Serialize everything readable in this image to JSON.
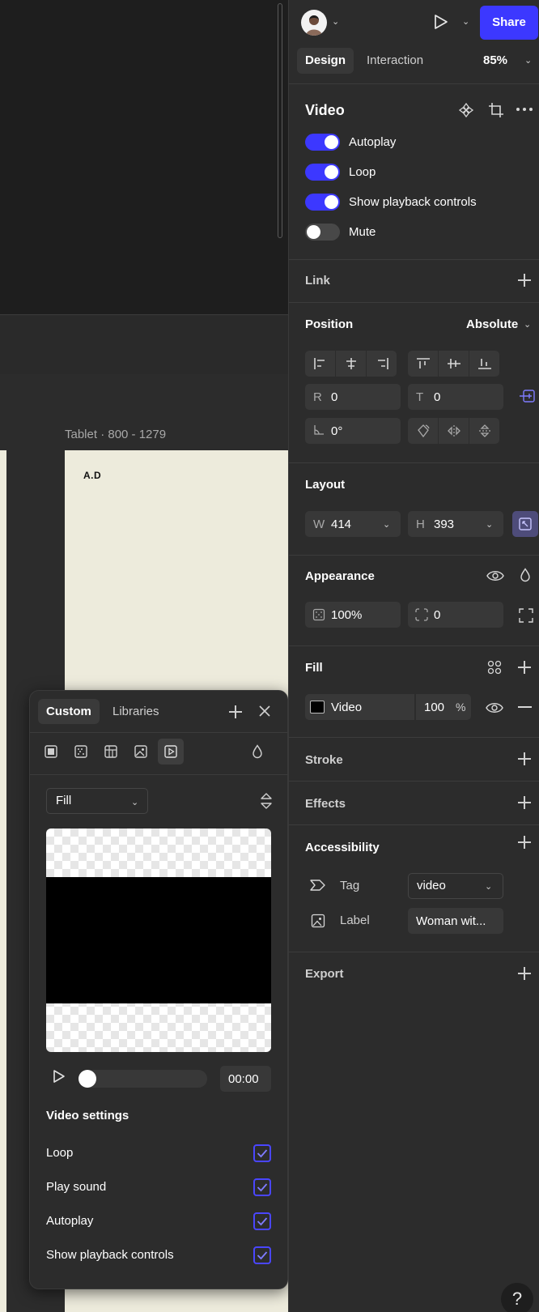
{
  "header": {
    "share_label": "Share",
    "tabs": [
      {
        "label": "Design",
        "active": true
      },
      {
        "label": "Interaction",
        "active": false
      }
    ],
    "zoom": "85%"
  },
  "canvas": {
    "frame_label": "Tablet · 800 - 1279",
    "frame_text": "A.D"
  },
  "video": {
    "title": "Video",
    "toggles": [
      {
        "label": "Autoplay",
        "on": true
      },
      {
        "label": "Loop",
        "on": true
      },
      {
        "label": "Show playback controls",
        "on": true
      },
      {
        "label": "Mute",
        "on": false
      }
    ]
  },
  "link": {
    "title": "Link"
  },
  "position": {
    "title": "Position",
    "mode": "Absolute",
    "r_label": "R",
    "r_value": "0",
    "t_label": "T",
    "t_value": "0",
    "rotation": "0°"
  },
  "layout": {
    "title": "Layout",
    "w_label": "W",
    "w_value": "414",
    "h_label": "H",
    "h_value": "393"
  },
  "appearance": {
    "title": "Appearance",
    "opacity": "100%",
    "radius": "0"
  },
  "fill": {
    "title": "Fill",
    "type": "Video",
    "opacity": "100",
    "percent": "%"
  },
  "stroke": {
    "title": "Stroke"
  },
  "effects": {
    "title": "Effects"
  },
  "accessibility": {
    "title": "Accessibility",
    "tag_label": "Tag",
    "tag_value": "video",
    "label_label": "Label",
    "label_value": "Woman wit..."
  },
  "export": {
    "title": "Export"
  },
  "help": "?",
  "popup": {
    "tabs": [
      {
        "label": "Custom",
        "active": true
      },
      {
        "label": "Libraries",
        "active": false
      }
    ],
    "fill_mode": "Fill",
    "time": "00:00",
    "progress": 0,
    "settings_title": "Video settings",
    "settings": [
      {
        "label": "Loop",
        "checked": true
      },
      {
        "label": "Play sound",
        "checked": true
      },
      {
        "label": "Autoplay",
        "checked": true
      },
      {
        "label": "Show playback controls",
        "checked": true
      }
    ]
  },
  "colors": {
    "accent": "#3c38ff",
    "panel": "#2c2c2c",
    "canvas_dark": "#1e1e1e",
    "frame": "#edebdc"
  }
}
